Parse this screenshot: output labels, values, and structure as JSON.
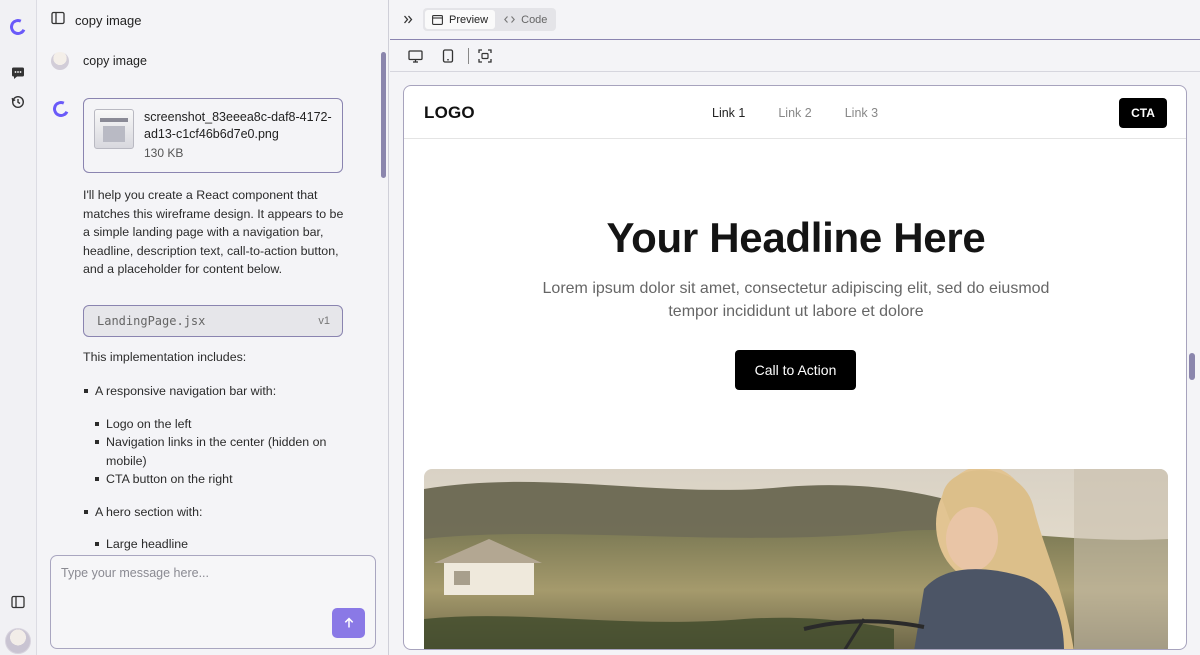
{
  "chat": {
    "title": "copy image",
    "user_message": "copy image",
    "attachment": {
      "name": "screenshot_83eeea8c-daf8-4172-ad13-c1cf46b6d7e0.png",
      "size": "130 KB"
    },
    "assistant_intro": "I'll help you create a React component that matches this wireframe design. It appears to be a simple landing page with a navigation bar, headline, description text, call-to-action button, and a placeholder for content below.",
    "code_artifact": {
      "name": "LandingPage.jsx",
      "version": "v1"
    },
    "list_intro": "This implementation includes:",
    "list": [
      {
        "label": "A responsive navigation bar with:",
        "children": [
          "Logo on the left",
          "Navigation links in the center (hidden on mobile)",
          "CTA button on the right"
        ]
      },
      {
        "label": "A hero section with:",
        "children": [
          "Large headline"
        ]
      }
    ],
    "input_placeholder": "Type your message here..."
  },
  "toolbar": {
    "tabs": [
      {
        "label": "Preview",
        "active": true
      },
      {
        "label": "Code",
        "active": false
      }
    ]
  },
  "site": {
    "logo": "LOGO",
    "links": [
      "Link 1",
      "Link 2",
      "Link 3"
    ],
    "cta": "CTA",
    "headline": "Your Headline Here",
    "description": "Lorem ipsum dolor sit amet, consectetur adipiscing elit, sed do eiusmod tempor incididunt ut labore et dolore",
    "button": "Call to Action"
  },
  "colors": {
    "accent": "#6a5af9",
    "send_button": "#8a79e6",
    "border_accent": "#8a84b0"
  }
}
